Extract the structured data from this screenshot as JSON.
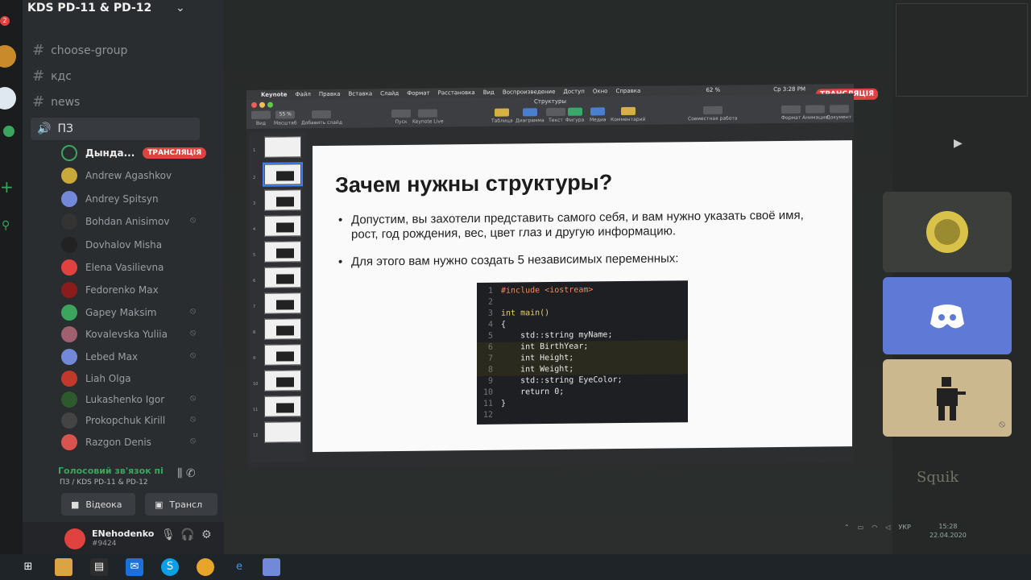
{
  "server": {
    "name": "KDS PD-11 & PD-12",
    "badge": "2"
  },
  "channels": [
    {
      "name": "choose-group"
    },
    {
      "name": "кдс"
    },
    {
      "name": "news"
    }
  ],
  "voice_channel": {
    "name": "ПЗ"
  },
  "members": [
    {
      "name": "Дында...",
      "badge": "ТРАНСЛЯЦІЯ",
      "color": "#1f1f1f"
    },
    {
      "name": "Andrew Agashkov",
      "color": "#c9a93a"
    },
    {
      "name": "Andrey Spitsyn",
      "color": "#7289da"
    },
    {
      "name": "Bohdan Anisimov",
      "color": "#333",
      "muted": "🎙"
    },
    {
      "name": "Dovhalov Misha",
      "color": "#222"
    },
    {
      "name": "Elena Vasilievna",
      "color": "#e0423f"
    },
    {
      "name": "Fedorenko Max",
      "color": "#8a1c1c"
    },
    {
      "name": "Gapey Maksim",
      "color": "#3ba55d",
      "muted": "🎙"
    },
    {
      "name": "Kovalevska Yuliia",
      "color": "#a06070",
      "muted": "🎙"
    },
    {
      "name": "Lebed Max",
      "color": "#7289da",
      "muted": "🎙"
    },
    {
      "name": "Liah Olga",
      "color": "#c0392b"
    },
    {
      "name": "Lukashenko Igor",
      "color": "#2d5a2d",
      "muted": "🎙"
    },
    {
      "name": "Prokopchuk Kirill",
      "color": "#444",
      "muted": "🎙"
    },
    {
      "name": "Razgon Denis",
      "color": "#d9534f",
      "muted": "🎙"
    }
  ],
  "voice_connection": {
    "status": "Голосовий зв'язок пі",
    "location": "ПЗ / KDS PD-11 & PD-12",
    "video_label": "Відеока",
    "stream_label": "Трансл"
  },
  "user": {
    "name": "ENehodenko",
    "tag": "#9424"
  },
  "keynote": {
    "app": "Keynote",
    "menus": [
      "Файл",
      "Правка",
      "Вставка",
      "Слайд",
      "Формат",
      "Расстановка",
      "Вид",
      "Воспроизведение",
      "Доступ",
      "Окно",
      "Справка"
    ],
    "clock": "Ср 3:28 PM",
    "battery": "62 %",
    "window_title": "Структуры",
    "live_tag": "ТРАНСЛЯЦІЯ",
    "toolbar": [
      "Вид",
      "Масштаб",
      "Добавить слайд",
      "Пуск",
      "Keynote Live",
      "Таблица",
      "Диаграмма",
      "Текст",
      "Фигура",
      "Медиа",
      "Комментарий",
      "Совместная работа",
      "Формат",
      "Анимация",
      "Документ"
    ],
    "zoom": "55 %"
  },
  "slide": {
    "title": "Зачем нужны структуры?",
    "bullets": [
      "Допустим, вы захотели представить самого себя, и вам нужно указать своё имя, рост, год рождения, вес, цвет глаз и другую информацию.",
      "Для этого вам нужно создать 5 независимых переменных:"
    ],
    "code": [
      {
        "n": "1",
        "t": "#include <iostream>",
        "c": "pp"
      },
      {
        "n": "2",
        "t": "",
        "c": "tx"
      },
      {
        "n": "3",
        "t": "int main()",
        "c": "ty"
      },
      {
        "n": "4",
        "t": "{",
        "c": "tx"
      },
      {
        "n": "5",
        "t": "    std::string myName;",
        "c": "tx"
      },
      {
        "n": "6",
        "t": "    int BirthYear;",
        "c": "tx",
        "hl": true
      },
      {
        "n": "7",
        "t": "    int Height;",
        "c": "tx",
        "hl": true
      },
      {
        "n": "8",
        "t": "    int Weight;",
        "c": "tx",
        "hl": true
      },
      {
        "n": "9",
        "t": "    std::string EyeColor;",
        "c": "tx"
      },
      {
        "n": "10",
        "t": "    return 0;",
        "c": "tx"
      },
      {
        "n": "11",
        "t": "}",
        "c": "tx"
      },
      {
        "n": "12",
        "t": "",
        "c": "tx"
      }
    ]
  },
  "slide_thumbs": [
    "1",
    "2",
    "3",
    "4",
    "5",
    "6",
    "7",
    "8",
    "9",
    "10",
    "11",
    "12"
  ],
  "right_panel": {
    "brand": "Squik"
  },
  "tray": {
    "lang": "УКР",
    "time": "15:28",
    "date": "22.04.2020"
  }
}
